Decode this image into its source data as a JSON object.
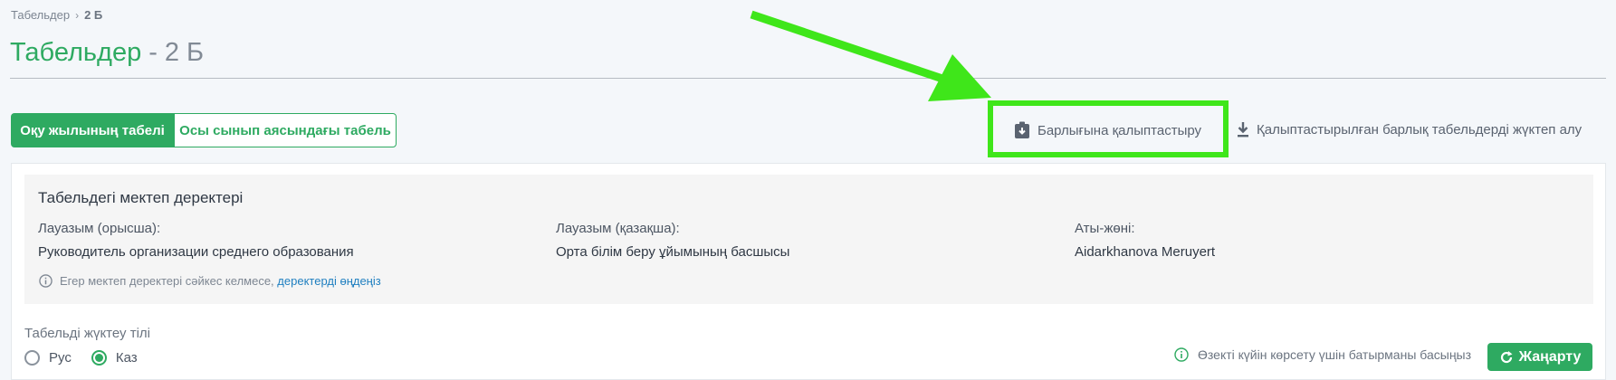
{
  "breadcrumb": {
    "root": "Табельдер",
    "separator": "›",
    "current": "2 Б"
  },
  "page": {
    "title_main": "Табельдер",
    "title_sep": "-",
    "title_class": "2 Б"
  },
  "tabs": [
    {
      "label": "Оқу жылының табелі",
      "active": true
    },
    {
      "label": "Осы сынып аясындағы табель",
      "active": false
    }
  ],
  "actions": {
    "form_all": "Барлығына қалыптастыру",
    "download_all": "Қалыптастырылған барлық табельдерді жүктеп алу"
  },
  "school_info": {
    "title": "Табельдегі мектеп деректері",
    "fields": [
      {
        "label": "Лауазым (орысша):",
        "value": "Руководитель организации среднего образования"
      },
      {
        "label": "Лауазым (қазақша):",
        "value": "Орта білім беру ұйымының басшысы"
      },
      {
        "label": "Аты-жөні:",
        "value": "Aidarkhanova Meruyert"
      }
    ],
    "note_text": "Егер мектеп деректері сәйкес келмесе,",
    "note_link": "деректерді өңдеңіз"
  },
  "language": {
    "label": "Табельді жүктеу тілі",
    "options": [
      {
        "label": "Рус",
        "selected": false
      },
      {
        "label": "Каз",
        "selected": true
      }
    ]
  },
  "refresh": {
    "hint": "Өзекті күйін көрсету үшін батырманы басыңыз",
    "button_label": "Жаңарту"
  },
  "colors": {
    "accent": "#2eaa61",
    "highlight": "#3fe61a",
    "link": "#1f7fc0"
  }
}
